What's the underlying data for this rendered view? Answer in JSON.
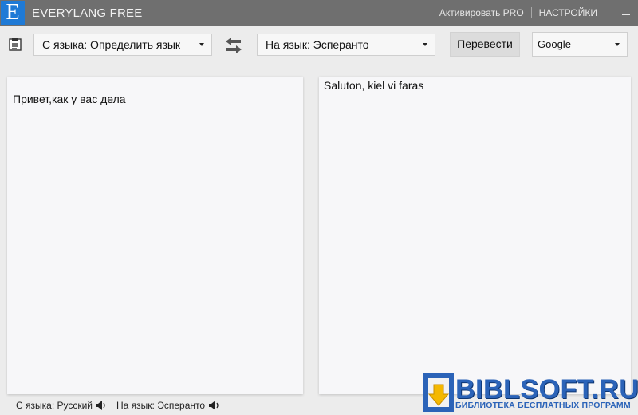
{
  "window": {
    "logo_letter": "E",
    "title": "EVERYLANG FREE",
    "activate_pro": "Активировать PRO",
    "settings": "НАСТРОЙКИ"
  },
  "toolbar": {
    "source_language": "С языка: Определить язык",
    "target_language": "На язык: Эсперанто",
    "translate_label": "Перевести",
    "service": "Google"
  },
  "source_panel": {
    "text": "Привет,как у вас дела"
  },
  "result_panel": {
    "text": "Saluton, kiel vi faras"
  },
  "status_bar": {
    "source": "С языка: Русский",
    "target": "На язык: Эсперанто"
  },
  "watermark": {
    "name": "BIBLSOFT.RU",
    "subtitle": "БИБЛИОТЕКА БЕСПЛАТНЫХ ПРОГРАММ"
  },
  "colors": {
    "titlebar": "#6f6f6f",
    "logo": "#1f7ad6",
    "background": "#ececec",
    "panel": "#f7f7f9",
    "watermark": "#2b63b8"
  },
  "icons": [
    "clipboard-icon",
    "swap-languages-icon",
    "speaker-icon",
    "minimize-icon"
  ]
}
